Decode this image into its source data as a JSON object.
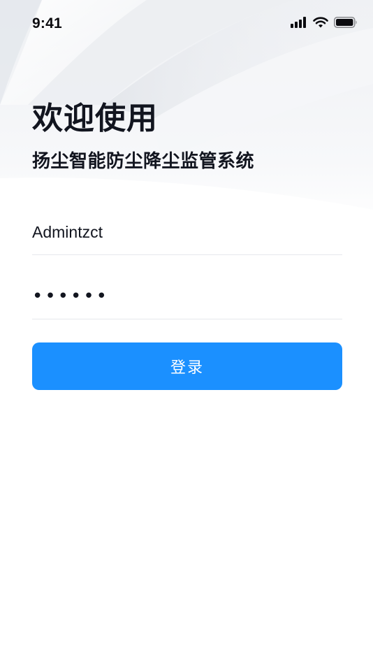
{
  "status_bar": {
    "time": "9:41",
    "icons": [
      "cellular-signal-icon",
      "wifi-icon",
      "battery-icon"
    ]
  },
  "welcome": {
    "title": "欢迎使用",
    "subtitle": "扬尘智能防尘降尘监管系统"
  },
  "form": {
    "username_value": "Admintzct",
    "password_value": "123456"
  },
  "actions": {
    "login_label": "登录"
  },
  "colors": {
    "primary": "#1b90ff",
    "text": "#12151f",
    "divider": "#e6e8ec"
  }
}
